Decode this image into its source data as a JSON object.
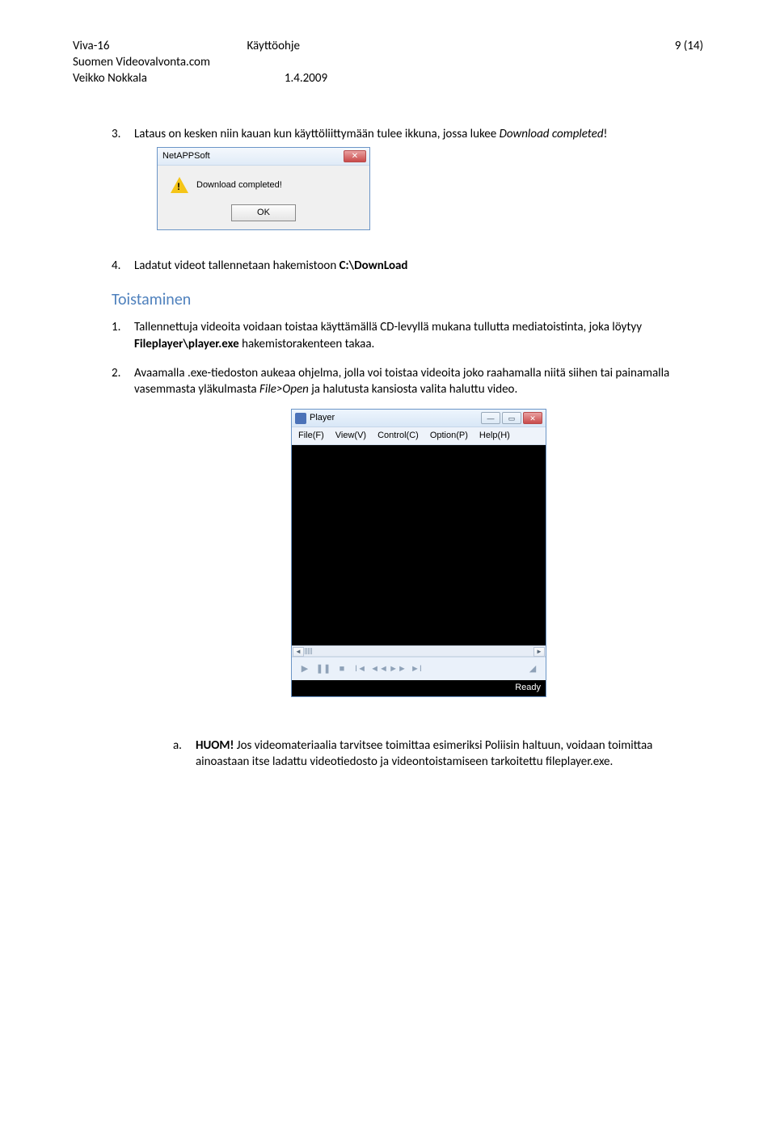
{
  "header": {
    "left1": "Viva-16",
    "left2": "Suomen Videovalvonta.com",
    "left3": "Veikko Nokkala",
    "center1": "Käyttöohje",
    "center2": "1.4.2009",
    "right": "9 (14)"
  },
  "body": {
    "item3_num": "3.",
    "item3_text_a": "Lataus on kesken niin kauan kun käyttöliittymään tulee ikkuna, jossa lukee ",
    "item3_text_b_italic": "Download completed",
    "item3_text_c": "!",
    "item4_num": "4.",
    "item4_text_a": "Ladatut videot tallennetaan hakemistoon ",
    "item4_text_b_bold": "C:\\DownLoad",
    "section_title": "Toistaminen",
    "t1_num": "1.",
    "t1_a": "Tallennettuja videoita voidaan toistaa käyttämällä CD-levyllä mukana tullutta mediatoistinta, joka löytyy ",
    "t1_b_bold": "Fileplayer\\player.exe",
    "t1_c": " hakemistorakenteen takaa.",
    "t2_num": "2.",
    "t2_a": "Avaamalla .exe-tiedoston aukeaa ohjelma, jolla voi toistaa videoita joko raahamalla niitä siihen tai painamalla vasemmasta yläkulmasta ",
    "t2_b_italic": "File>Open",
    "t2_c": " ja halutusta kansiosta valita haluttu video.",
    "note_num": "a.",
    "note_a_bold": "HUOM!",
    "note_b": " Jos videomateriaalia tarvitsee toimittaa esimeriksi Poliisin haltuun, voidaan toimittaa ainoastaan itse ladattu videotiedosto ja videontoistamiseen tarkoitettu fileplayer.exe."
  },
  "dialog1": {
    "title": "NetAPPSoft",
    "message": "Download completed!",
    "ok": "OK"
  },
  "player": {
    "title": "Player",
    "menu": [
      "File(F)",
      "View(V)",
      "Control(C)",
      "Option(P)",
      "Help(H)"
    ],
    "status": "Ready"
  }
}
